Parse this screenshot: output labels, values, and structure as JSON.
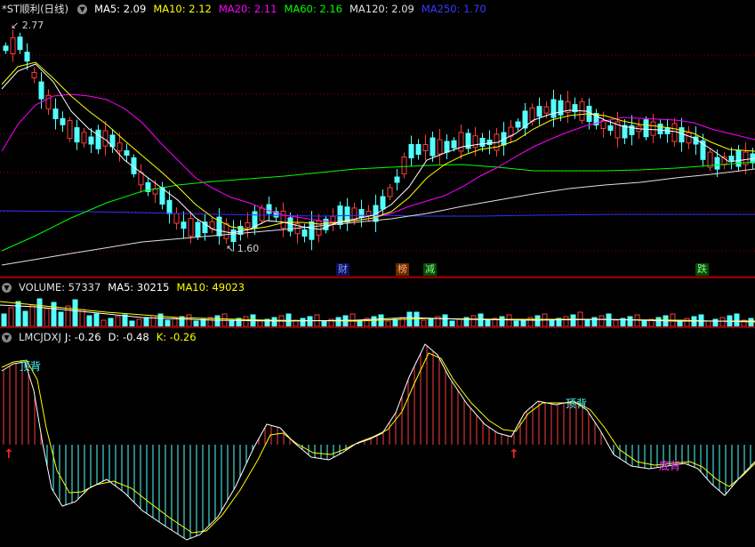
{
  "colors": {
    "up": "#ff3b3b",
    "down": "#54ffff",
    "ma5": "#ffffff",
    "ma10": "#ffff00",
    "ma20": "#ff00ff",
    "ma60": "#00ff00",
    "ma120": "#e0e0e0",
    "ma250": "#3030ff",
    "grid": "#8b0000",
    "label": "#c0c0c0"
  },
  "price_panel": {
    "title": "*ST顺利(日线)",
    "icon": "circle-down-icon",
    "ma5": "MA5: 2.09",
    "ma10": "MA10: 2.12",
    "ma20": "MA20: 2.11",
    "ma60": "MA60: 2.16",
    "ma120": "MA120: 2.09",
    "ma250": "MA250: 1.70",
    "high_label": "2.77",
    "low_label": "1.60",
    "events": [
      {
        "text": "财",
        "color": "#4f7bff"
      },
      {
        "text": "榜",
        "color": "#ff7f27"
      },
      {
        "text": "减",
        "color": "#3cd23c"
      },
      {
        "text": "跌",
        "color": "#3cd23c"
      }
    ]
  },
  "volume_panel": {
    "volume": "VOLUME: 57337",
    "ma5": "MA5: 30215",
    "ma10": "MA10: 49023"
  },
  "indicator_panel": {
    "name": "LMCJDXJ",
    "j": "J: -0.26",
    "d": "D: -0.48",
    "k": "K: -0.26",
    "signal_top_1": "顶背",
    "signal_top_2": "顶背",
    "signal_bottom": "底背"
  }
}
